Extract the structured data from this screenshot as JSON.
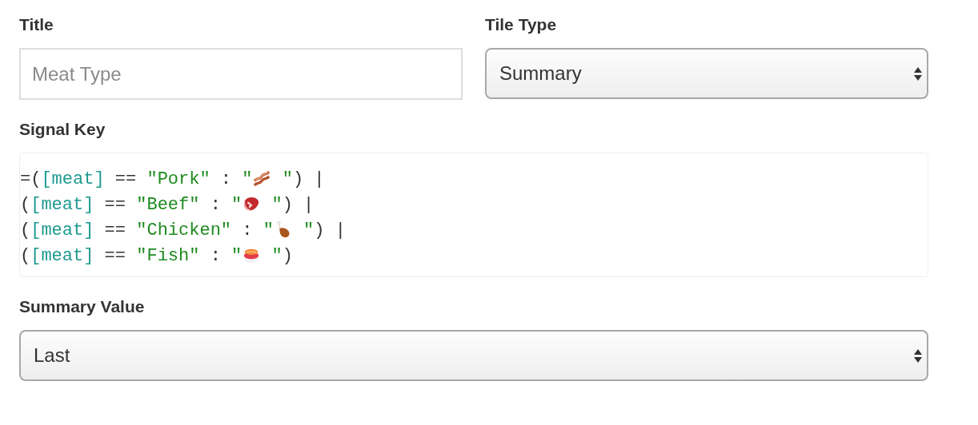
{
  "title_field": {
    "label": "Title",
    "placeholder": "Meat Type"
  },
  "tile_type": {
    "label": "Tile Type",
    "value": "Summary"
  },
  "signal_key": {
    "label": "Signal Key",
    "lines": [
      {
        "segments": [
          {
            "kind": "plain",
            "text": "=("
          },
          {
            "kind": "field",
            "text": "[meat]"
          },
          {
            "kind": "plain",
            "text": " == "
          },
          {
            "kind": "string",
            "text": "\"Pork\""
          },
          {
            "kind": "plain",
            "text": " : "
          },
          {
            "kind": "string",
            "text": "\""
          },
          {
            "kind": "bacon"
          },
          {
            "kind": "string",
            "text": " \""
          },
          {
            "kind": "plain",
            "text": ") |"
          }
        ]
      },
      {
        "segments": [
          {
            "kind": "plain",
            "text": "("
          },
          {
            "kind": "field",
            "text": "[meat]"
          },
          {
            "kind": "plain",
            "text": " == "
          },
          {
            "kind": "string",
            "text": "\"Beef\""
          },
          {
            "kind": "plain",
            "text": " : "
          },
          {
            "kind": "string",
            "text": "\""
          },
          {
            "kind": "steak"
          },
          {
            "kind": "string",
            "text": " \""
          },
          {
            "kind": "plain",
            "text": ") |"
          }
        ]
      },
      {
        "segments": [
          {
            "kind": "plain",
            "text": "("
          },
          {
            "kind": "field",
            "text": "[meat]"
          },
          {
            "kind": "plain",
            "text": " == "
          },
          {
            "kind": "string",
            "text": "\"Chicken\""
          },
          {
            "kind": "plain",
            "text": " : "
          },
          {
            "kind": "string",
            "text": "\""
          },
          {
            "kind": "drumstick"
          },
          {
            "kind": "string",
            "text": " \""
          },
          {
            "kind": "plain",
            "text": ") |"
          }
        ]
      },
      {
        "segments": [
          {
            "kind": "plain",
            "text": "("
          },
          {
            "kind": "field",
            "text": "[meat]"
          },
          {
            "kind": "plain",
            "text": " == "
          },
          {
            "kind": "string",
            "text": "\"Fish\""
          },
          {
            "kind": "plain",
            "text": " : "
          },
          {
            "kind": "string",
            "text": "\""
          },
          {
            "kind": "sushi"
          },
          {
            "kind": "string",
            "text": " \""
          },
          {
            "kind": "plain",
            "text": ")"
          }
        ]
      }
    ]
  },
  "summary_value": {
    "label": "Summary Value",
    "value": "Last"
  }
}
